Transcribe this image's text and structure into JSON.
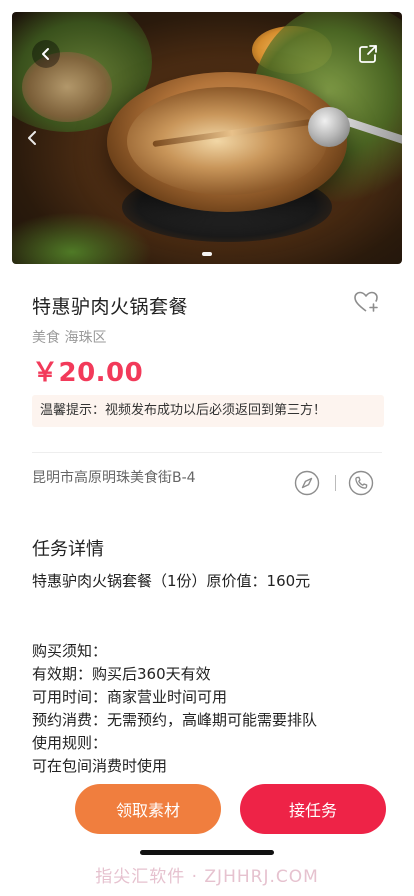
{
  "hero": {
    "back_icon": "chevron-left-icon",
    "share_icon": "share-icon",
    "prev_icon": "chevron-left-icon",
    "pager_dots": 1
  },
  "product": {
    "title": "特惠驴肉火锅套餐",
    "category": "美食 海珠区",
    "price": "￥20.00",
    "notice": "温馨提示：视频发布成功以后必须返回到第三方！",
    "favorite_icon": "heart-plus-icon",
    "colors": {
      "price": "#f23a5a",
      "notice_bg": "#fdf4ef"
    }
  },
  "location": {
    "address": "昆明市高原明珠美食街B-4",
    "nav_icon": "compass-icon",
    "phone_icon": "phone-icon"
  },
  "details": {
    "section_title": "任务详情",
    "package_line": "特惠驴肉火锅套餐（1份）原价值：160元",
    "rules": [
      "购买须知：",
      "有效期：购买后360天有效",
      "可用时间：商家营业时间可用",
      "预约消费：无需预约，高峰期可能需要排队",
      "使用规则：",
      "可在包间消费时使用"
    ]
  },
  "actions": {
    "left_label": "领取素材",
    "right_label": "接任务",
    "colors": {
      "left": "#f07e3e",
      "right": "#ee2347"
    }
  },
  "watermark": "指尖汇软件 · ZJHHRJ.COM"
}
